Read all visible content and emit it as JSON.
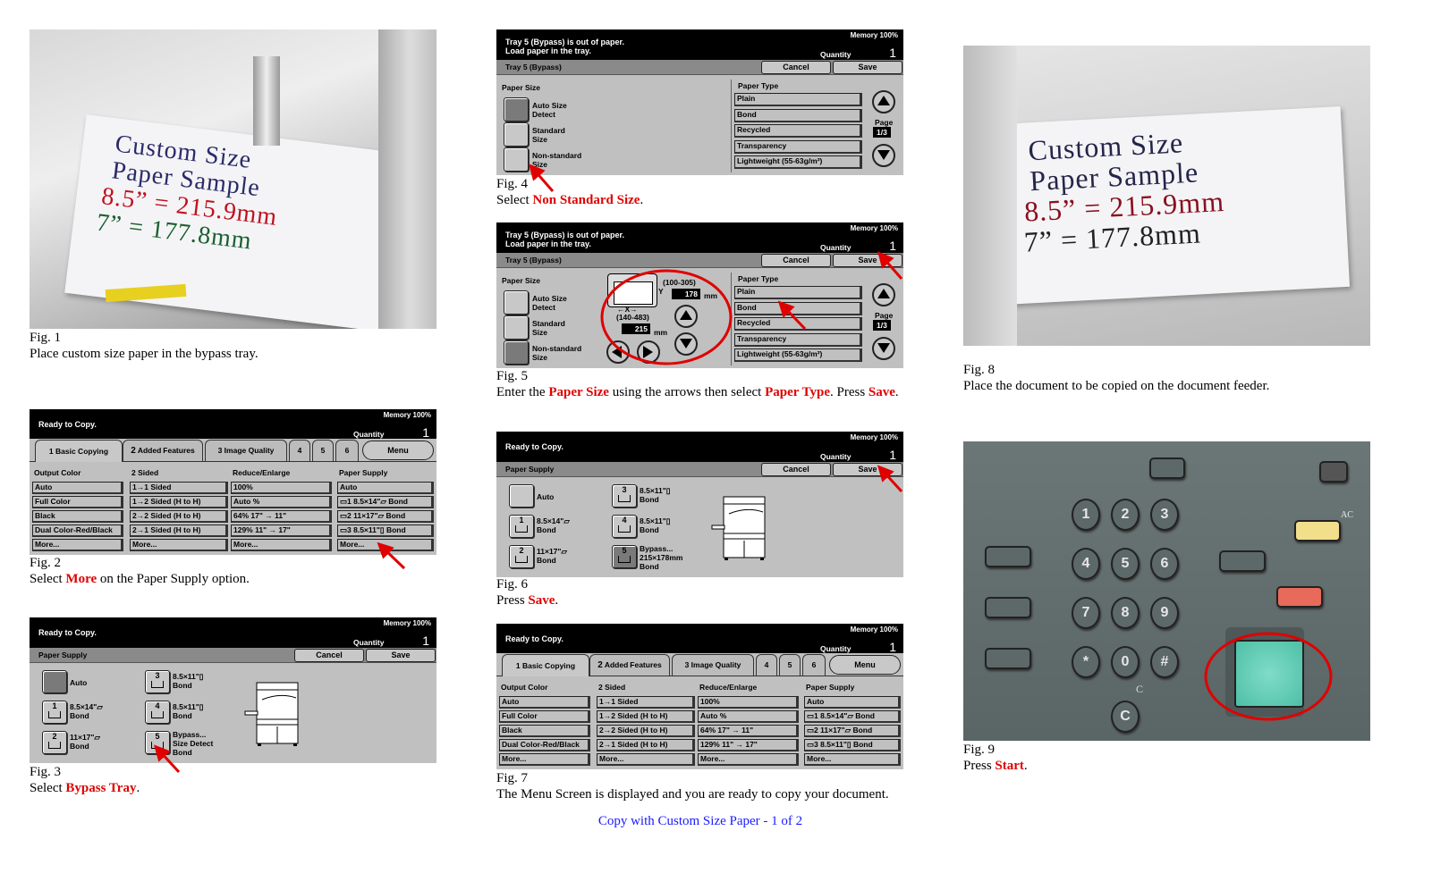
{
  "footer": "Copy with Custom Size Paper - 1 of 2",
  "colors": {
    "accent_red": "#e00000",
    "footer_blue": "#1a1aff",
    "start_button": "#5ec8b0"
  },
  "figures": {
    "fig1": {
      "label": "Fig. 1",
      "caption": [
        {
          "t": "Place custom size paper in the bypass tray.",
          "em": false
        }
      ],
      "paper_text": [
        "Custom Size",
        "Paper Sample",
        "8.5” = 215.9mm",
        "7” = 177.8mm"
      ]
    },
    "fig2": {
      "label": "Fig. 2",
      "caption": [
        {
          "t": "Select ",
          "em": false
        },
        {
          "t": "More",
          "em": true
        },
        {
          "t": " on the Paper Supply option.",
          "em": false
        }
      ]
    },
    "fig3": {
      "label": "Fig. 3",
      "caption": [
        {
          "t": "Select ",
          "em": false
        },
        {
          "t": "Bypass Tray",
          "em": true
        },
        {
          "t": ".",
          "em": false
        }
      ]
    },
    "fig4": {
      "label": "Fig. 4",
      "caption": [
        {
          "t": "Select ",
          "em": false
        },
        {
          "t": "Non Standard Size",
          "em": true
        },
        {
          "t": ".",
          "em": false
        }
      ]
    },
    "fig5": {
      "label": "Fig. 5",
      "caption": [
        {
          "t": "Enter the ",
          "em": false
        },
        {
          "t": "Paper Size",
          "em": true
        },
        {
          "t": " using the arrows then select ",
          "em": false
        },
        {
          "t": "Paper Type",
          "em": true
        },
        {
          "t": ".  Press ",
          "em": false
        },
        {
          "t": "Save",
          "em": true
        },
        {
          "t": ".",
          "em": false
        }
      ]
    },
    "fig6": {
      "label": "Fig. 6",
      "caption": [
        {
          "t": "Press ",
          "em": false
        },
        {
          "t": "Save",
          "em": true
        },
        {
          "t": ".",
          "em": false
        }
      ]
    },
    "fig7": {
      "label": "Fig. 7",
      "caption": [
        {
          "t": "The Menu Screen is displayed and you are ready to copy your document.",
          "em": false
        }
      ]
    },
    "fig8": {
      "label": "Fig. 8",
      "caption": [
        {
          "t": "Place the document to be copied on the document feeder.",
          "em": false
        }
      ],
      "paper_text": [
        "Custom Size",
        "Paper Sample",
        "8.5” = 215.9mm",
        "7” = 177.8mm"
      ]
    },
    "fig9": {
      "label": "Fig. 9",
      "caption": [
        {
          "t": "Press ",
          "em": false
        },
        {
          "t": "Start",
          "em": true
        },
        {
          "t": ".",
          "em": false
        }
      ],
      "keys": [
        "1",
        "2",
        "3",
        "4",
        "5",
        "6",
        "7",
        "8",
        "9",
        "*",
        "0",
        "#"
      ],
      "clear_label": "C",
      "clear_key": "C",
      "ac_label": "AC"
    }
  },
  "panels": {
    "basic": {
      "status": [
        "Ready to Copy."
      ],
      "memory": "Memory 100%",
      "quantity_label": "Quantity",
      "quantity": "1",
      "tabs": [
        [
          "1 Basic Copying"
        ],
        [
          "2",
          "Added",
          "Features"
        ],
        [
          "3 Image Quality"
        ],
        [
          "4"
        ],
        [
          "5"
        ],
        [
          "6"
        ]
      ],
      "menu": "Menu",
      "columns": [
        {
          "title": "Output Color",
          "items": [
            "Auto",
            "Full Color",
            "Black",
            "Dual Color-Red/Black",
            "More..."
          ]
        },
        {
          "title": "2 Sided",
          "items": [
            "1→1 Sided",
            "1→2 Sided (H to H)",
            "2→2 Sided (H to H)",
            "2→1 Sided (H to H)",
            "More..."
          ]
        },
        {
          "title": "Reduce/Enlarge",
          "items": [
            "100%",
            "Auto %",
            "64%  17\" → 11\"",
            "129% 11\" → 17\"",
            "More..."
          ]
        },
        {
          "title": "Paper Supply",
          "items": [
            "Auto",
            "▭1  8.5×14\"▱     Bond",
            "▭2  11×17\"▱      Bond",
            "▭3  8.5×11\"▯      Bond",
            "More..."
          ]
        }
      ]
    },
    "supply3": {
      "status": [
        "Ready to Copy."
      ],
      "memory": "Memory 100%",
      "quantity_label": "Quantity",
      "quantity": "1",
      "title": "Paper Supply",
      "cancel": "Cancel",
      "save": "Save",
      "selected": 0,
      "trays": [
        {
          "num": "",
          "lines": [
            "Auto"
          ]
        },
        {
          "num": "1",
          "lines": [
            "8.5×14\"▱",
            "Bond"
          ]
        },
        {
          "num": "2",
          "lines": [
            "11×17\"▱",
            "Bond"
          ]
        },
        {
          "num": "3",
          "lines": [
            "8.5×11\"▯",
            "Bond"
          ]
        },
        {
          "num": "4",
          "lines": [
            "8.5×11\"▯",
            "Bond"
          ]
        },
        {
          "num": "5",
          "lines": [
            "Bypass...",
            "Size Detect",
            "Bond"
          ]
        }
      ]
    },
    "supply6": {
      "status": [
        "Ready to Copy."
      ],
      "memory": "Memory 100%",
      "quantity_label": "Quantity",
      "quantity": "1",
      "title": "Paper Supply",
      "cancel": "Cancel",
      "save": "Save",
      "selected": 5,
      "trays": [
        {
          "num": "",
          "lines": [
            "Auto"
          ]
        },
        {
          "num": "1",
          "lines": [
            "8.5×14\"▱",
            "Bond"
          ]
        },
        {
          "num": "2",
          "lines": [
            "11×17\"▱",
            "Bond"
          ]
        },
        {
          "num": "3",
          "lines": [
            "8.5×11\"▯",
            "Bond"
          ]
        },
        {
          "num": "4",
          "lines": [
            "8.5×11\"▯",
            "Bond"
          ]
        },
        {
          "num": "5",
          "lines": [
            "Bypass...",
            "215×178mm",
            "Bond"
          ]
        }
      ]
    },
    "tray4": {
      "status": [
        "Tray 5 (Bypass) is out of paper.",
        "Load paper in the tray."
      ],
      "memory": "Memory 100%",
      "quantity_label": "Quantity",
      "quantity": "1",
      "title": "Tray 5 (Bypass)",
      "cancel": "Cancel",
      "save": "Save",
      "paper_size_label": "Paper Size",
      "size_selected": 0,
      "sizes": [
        [
          "Auto Size",
          "Detect"
        ],
        [
          "Standard",
          "Size"
        ],
        [
          "Non-standard",
          "Size"
        ]
      ],
      "paper_type_label": "Paper Type",
      "type_selected": 1,
      "types": [
        "Plain",
        "Bond",
        "Recycled",
        "Transparency",
        "Lightweight (55-63g/m²)"
      ],
      "page_label": "Page",
      "page": "1/3"
    },
    "tray5": {
      "status": [
        "Tray 5 (Bypass) is out of paper.",
        "Load paper in the tray."
      ],
      "memory": "Memory 100%",
      "quantity_label": "Quantity",
      "quantity": "1",
      "title": "Tray 5 (Bypass)",
      "cancel": "Cancel",
      "save": "Save",
      "paper_size_label": "Paper Size",
      "size_selected": 2,
      "sizes": [
        [
          "Auto Size",
          "Detect"
        ],
        [
          "Standard",
          "Size"
        ],
        [
          "Non-standard",
          "Size"
        ]
      ],
      "paper_type_label": "Paper Type",
      "type_selected": 1,
      "types": [
        "Plain",
        "Bond",
        "Recycled",
        "Transparency",
        "Lightweight (55-63g/m²)"
      ],
      "page_label": "Page",
      "page": "1/3",
      "custom": {
        "y_range": "(100-305)",
        "y_value": "178",
        "x_range": "(140-483)",
        "x_value": "215",
        "unit": "mm",
        "x_axis": "←X→",
        "y_axis": "Y"
      }
    }
  }
}
